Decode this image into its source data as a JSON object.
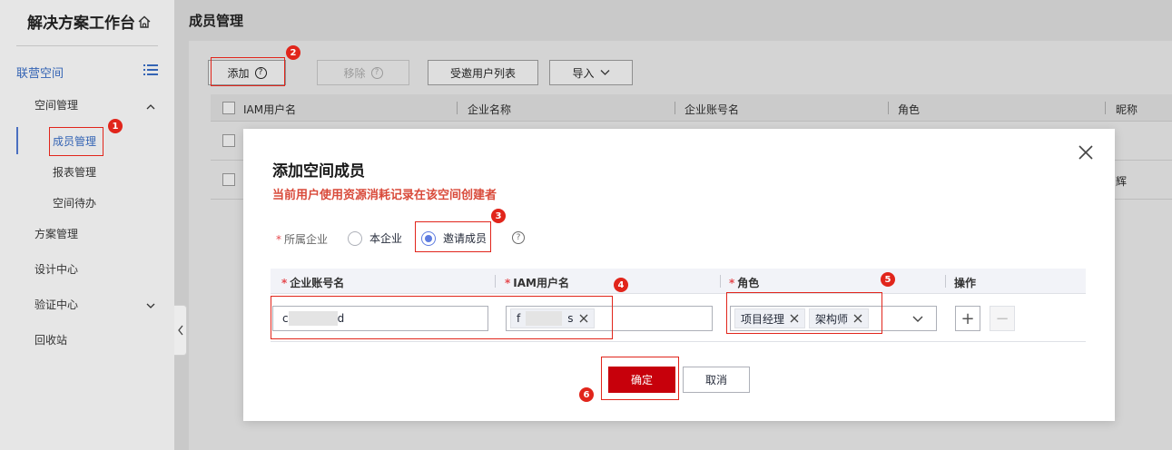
{
  "sidebar": {
    "title": "解决方案工作台",
    "space_label": "联营空间",
    "items": [
      {
        "label": "空间管理"
      },
      {
        "label": "成员管理"
      },
      {
        "label": "报表管理"
      },
      {
        "label": "空间待办"
      },
      {
        "label": "方案管理"
      },
      {
        "label": "设计中心"
      },
      {
        "label": "验证中心"
      },
      {
        "label": "回收站"
      }
    ]
  },
  "main": {
    "title": "成员管理",
    "toolbar": {
      "add_label": "添加",
      "remove_label": "移除",
      "invited_list_label": "受邀用户列表",
      "import_label": "导入"
    },
    "table": {
      "columns": [
        "IAM用户名",
        "企业名称",
        "企业账号名",
        "角色",
        "昵称"
      ],
      "row2_partial": "辉"
    }
  },
  "modal": {
    "title": "添加空间成员",
    "warning": "当前用户使用资源消耗记录在该空间创建者",
    "enterprise_label": "所属企业",
    "radio_own": "本企业",
    "radio_invite": "邀请成员",
    "columns": {
      "account": "企业账号名",
      "iam": "IAM用户名",
      "role": "角色",
      "ops": "操作"
    },
    "row": {
      "account_prefix": "c",
      "account_suffix": "d",
      "iam_prefix": "f",
      "iam_suffix": "s",
      "roles": [
        "项目经理",
        "架构师"
      ]
    },
    "confirm_label": "确定",
    "cancel_label": "取消"
  },
  "annotations": [
    "1",
    "2",
    "3",
    "4",
    "5",
    "6"
  ],
  "colors": {
    "primary": "#c7000b",
    "radio_selected": "#5e7ce0",
    "warning_text": "#d94a3a",
    "annotation": "#e1251b",
    "link_blue": "#3464b4"
  }
}
